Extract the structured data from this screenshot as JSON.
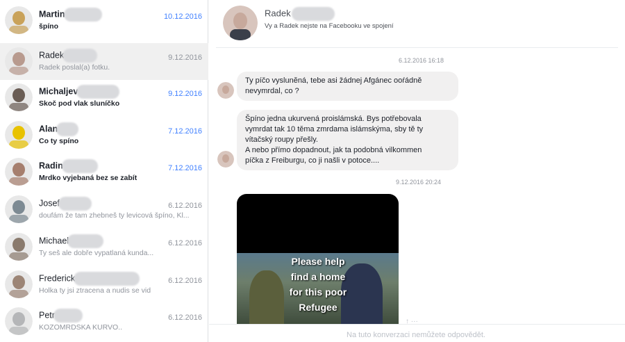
{
  "conversations": [
    {
      "name": "Martin",
      "snippet": "špíno",
      "date": "10.12.2016",
      "unread": true,
      "avatar_color": "#c9a25a"
    },
    {
      "name": "Radek",
      "snippet": "Radek poslal(a) fotku.",
      "date": "9.12.2016",
      "unread": false,
      "avatar_color": "#b89a8e"
    },
    {
      "name": "Michaljev",
      "snippet": "Skoč pod vlak sluníčko",
      "date": "9.12.2016",
      "unread": true,
      "avatar_color": "#6a5d55"
    },
    {
      "name": "Alan",
      "snippet": "Co ty spíno",
      "date": "7.12.2016",
      "unread": true,
      "avatar_color": "#e8c200"
    },
    {
      "name": "Radin",
      "snippet": "Mrdko vyjebaná bez se zabít",
      "date": "7.12.2016",
      "unread": true,
      "avatar_color": "#a67f6e"
    },
    {
      "name": "Josef",
      "snippet": "doufám že tam zhebneš ty levicová špíno, Kl...",
      "date": "6.12.2016",
      "unread": false,
      "avatar_color": "#7d8a93"
    },
    {
      "name": "Michael",
      "snippet": "Ty seš ale dobře vypatlaná kunda...",
      "date": "6.12.2016",
      "unread": false,
      "avatar_color": "#8a7a6d"
    },
    {
      "name": "Frederick",
      "snippet": "Holka ty jsi ztracena a nudis se vid",
      "date": "6.12.2016",
      "unread": false,
      "avatar_color": "#9c8576"
    },
    {
      "name": "Petr",
      "snippet": "KOZOMRDSKA KURVO..",
      "date": "6.12.2016",
      "unread": false,
      "avatar_color": "#b5b6b8"
    }
  ],
  "thread": {
    "name": "Radek",
    "note": "Vy a Radek nejste na Facebooku ve spojení",
    "timestamp1": "6.12.2016 16:18",
    "message1": [
      "Ty píčo vyslunĕná, tebe asi žádnej Afgánec ooŕádně",
      "nevymrdal, co ?"
    ],
    "message2": [
      "Špíno jedna ukurvená proislámská. Bys potřebovala",
      "vymrdat tak 10 těma zmrdama islámskýma, sby tě ty",
      "vítačský roupy přešly.",
      "A nebo přímo dopadnout, jak ta podobná vilkommen",
      "píčka z Freiburgu, co ji našli v potoce...."
    ],
    "timestamp2": "9.12.2016 20:24",
    "photo_caption": [
      "Please help",
      "find a home",
      "for this poor",
      "Refugee"
    ],
    "photo_actions": "↑ ···"
  },
  "footer_text": "Na tuto konverzaci nemůžete odpovědět.",
  "colors": {
    "accent": "#4080ff",
    "bubble": "#f1f0f0",
    "muted": "#90949c"
  }
}
